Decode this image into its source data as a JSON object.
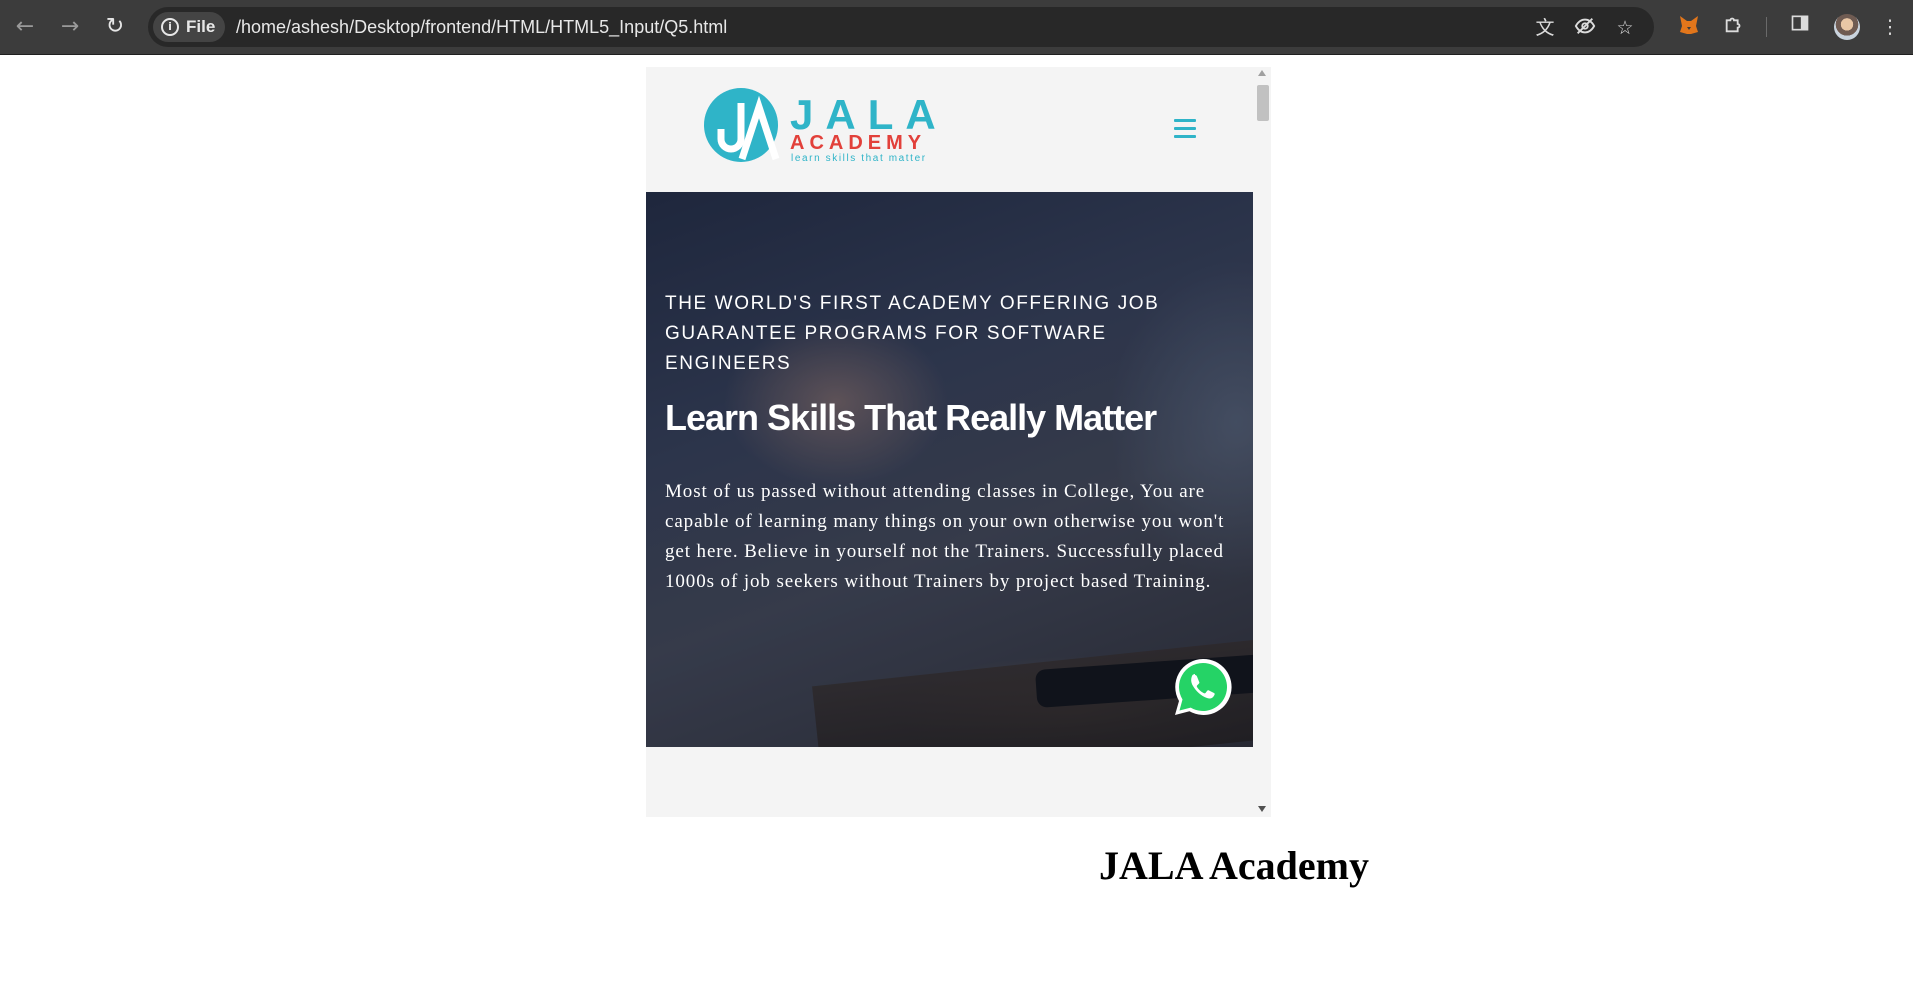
{
  "browser": {
    "nav": {
      "back_icon": "arrow-left-icon",
      "forward_icon": "arrow-right-icon",
      "reload_icon": "reload-icon"
    },
    "address_bar": {
      "scheme_label": "File",
      "url": "/home/ashesh/Desktop/frontend/HTML/HTML5_Input/Q5.html"
    },
    "address_icons": [
      "translate-icon",
      "eye-off-icon",
      "star-icon"
    ],
    "toolbar_icons": [
      "metamask-fox-icon",
      "extensions-puzzle-icon",
      "side-panel-icon",
      "profile-avatar",
      "more-vert-icon"
    ]
  },
  "embed": {
    "header": {
      "logo": {
        "wordmark": "JALA",
        "subword": "ACADEMY",
        "slogan": "learn skills that matter",
        "monogram": "JA"
      },
      "menu_icon": "hamburger-menu-icon"
    },
    "hero": {
      "tagline": "THE WORLD'S FIRST ACADEMY OFFERING JOB GUARANTEE PROGRAMS FOR SOFTWARE ENGINEERS",
      "headline": "Learn Skills That Really Matter",
      "description": "Most of us passed without attending classes in College, You are capable of learning many things on your own otherwise you won't get here. Believe in yourself not the Trainers. Successfully placed 1000s of job seekers without Trainers by project based Training.",
      "chat_icon": "whatsapp-icon"
    }
  },
  "page": {
    "heading": "JALA Academy"
  },
  "colors": {
    "brand_teal": "#2fb4c8",
    "brand_red": "#e2403a",
    "whatsapp_green": "#25d366"
  }
}
